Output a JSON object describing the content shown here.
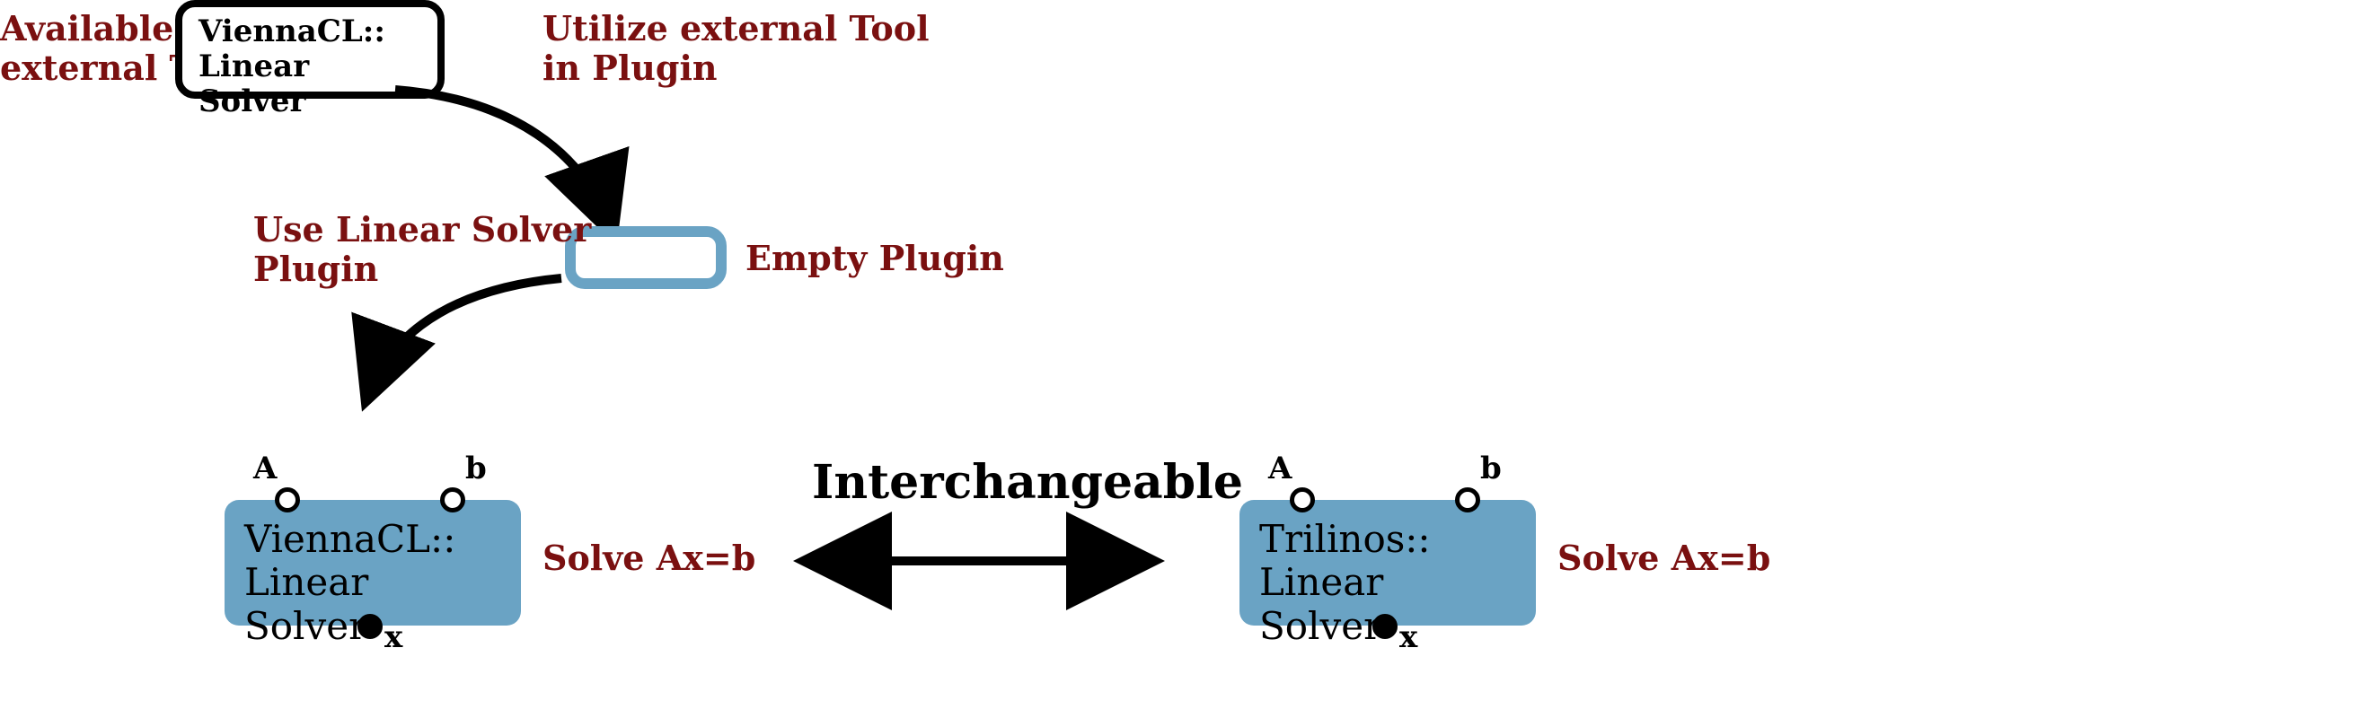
{
  "labels": {
    "available_external_tool": "Available\nexternal Tool",
    "utilize_external_tool": "Utilize external Tool\nin Plugin",
    "use_linear_solver_plugin": "Use Linear Solver\nPlugin",
    "empty_plugin": "Empty Plugin",
    "solve_left": "Solve Ax=b",
    "solve_right": "Solve Ax=b",
    "interchangeable": "Interchangeable"
  },
  "boxes": {
    "external_tool": {
      "line1": "ViennaCL::",
      "line2": "Linear Solver"
    },
    "plugin_left": {
      "line1": "ViennaCL::",
      "line2": "Linear Solver"
    },
    "plugin_right": {
      "line1": "Trilinos::",
      "line2": "Linear Solver"
    }
  },
  "ports": {
    "A": "A",
    "b": "b",
    "x": "x"
  }
}
